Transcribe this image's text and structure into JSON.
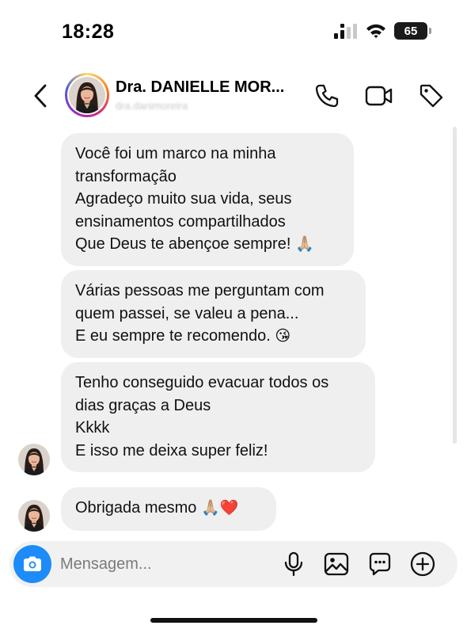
{
  "status_bar": {
    "time": "18:28",
    "battery": "65"
  },
  "header": {
    "contact_name": "Dra. DANIELLE MOR...",
    "contact_handle": "dra.danimoreira"
  },
  "messages": [
    {
      "lines": [
        "Você foi um marco na minha",
        "transformação",
        "Agradeço muito sua vida, seus",
        "ensinamentos compartilhados",
        "Que Deus te abençoe sempre!"
      ],
      "emoji": "🙏🏼"
    },
    {
      "lines": [
        "Várias pessoas me perguntam com",
        "quem passei, se valeu a pena...",
        "E eu sempre te recomendo."
      ],
      "emoji": "😘"
    },
    {
      "lines": [
        "Tenho conseguido evacuar todos os",
        "dias graças a Deus",
        "Kkkk",
        "E isso me deixa super feliz!"
      ]
    },
    {
      "lines": [
        "Obrigada mesmo"
      ],
      "emoji": "🙏🏼❤️"
    }
  ],
  "composer": {
    "placeholder": "Mensagem..."
  },
  "icons": {
    "back": "chevron-left-icon",
    "call": "phone-icon",
    "video": "video-camera-icon",
    "tag": "tag-icon",
    "camera": "camera-icon",
    "mic": "microphone-icon",
    "gallery": "image-icon",
    "sticker": "chat-bubble-icon",
    "add": "plus-circle-icon"
  },
  "colors": {
    "bubble": "#efefef",
    "camera_button": "#1d8cf8",
    "composer": "#f1f1f1"
  }
}
